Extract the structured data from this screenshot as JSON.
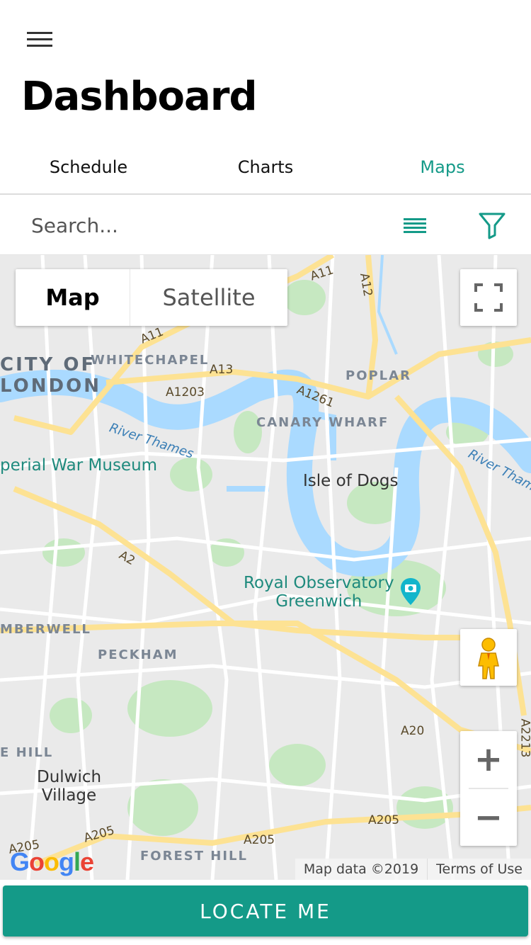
{
  "header": {
    "menu_icon": "hamburger-menu-icon",
    "title": "Dashboard"
  },
  "tabs": [
    {
      "label": "Schedule",
      "active": false
    },
    {
      "label": "Charts",
      "active": false
    },
    {
      "label": "Maps",
      "active": true
    }
  ],
  "search": {
    "placeholder": "Search...",
    "value": "",
    "list_icon": "list-view-icon",
    "filter_icon": "filter-icon"
  },
  "map": {
    "type_toggle": {
      "map": "Map",
      "satellite": "Satellite",
      "selected": "Map"
    },
    "labels": {
      "city_line1": "CITY OF",
      "city_line2": "LONDON",
      "whitechapel": "WHITECHAPEL",
      "poplar": "POPLAR",
      "canary_wharf": "CANARY WHARF",
      "river_thames_1": "River Thames",
      "river_thames_2": "River Thame",
      "imperial_war_museum": "perial War Museum",
      "isle_of_dogs": "Isle of Dogs",
      "royal_obs_line1": "Royal Observatory",
      "royal_obs_line2": "Greenwich",
      "camberwell": "MBERWELL",
      "peckham": "PECKHAM",
      "hill": "E HILL",
      "dulwich_line1": "Dulwich",
      "dulwich_line2": "Village",
      "forest_hill": "FOREST HILL",
      "a11_top": "A11",
      "a12": "A12",
      "a11": "A11",
      "a13": "A13",
      "a1203": "A1203",
      "a1261": "A1261",
      "a2": "A2",
      "a20": "A20",
      "a2213": "A2213",
      "a205_left": "A205",
      "a205_mid": "A205",
      "a205_right": "A205",
      "a205_partial": "A205"
    },
    "controls": {
      "fullscreen_icon": "fullscreen-icon",
      "pegman_icon": "street-view-pegman-icon",
      "zoom_in": "+",
      "zoom_out": "−"
    },
    "attribution": {
      "logo": "Google",
      "data": "Map data ©2019",
      "terms": "Terms of Use"
    },
    "colors": {
      "water": "#aadaff",
      "land": "#eaeaea",
      "park": "#c6e8c1",
      "major_road": "#fde293",
      "road": "#ffffff"
    }
  },
  "locate_button": {
    "label": "LOCATE ME"
  },
  "colors": {
    "accent": "#149a88"
  }
}
